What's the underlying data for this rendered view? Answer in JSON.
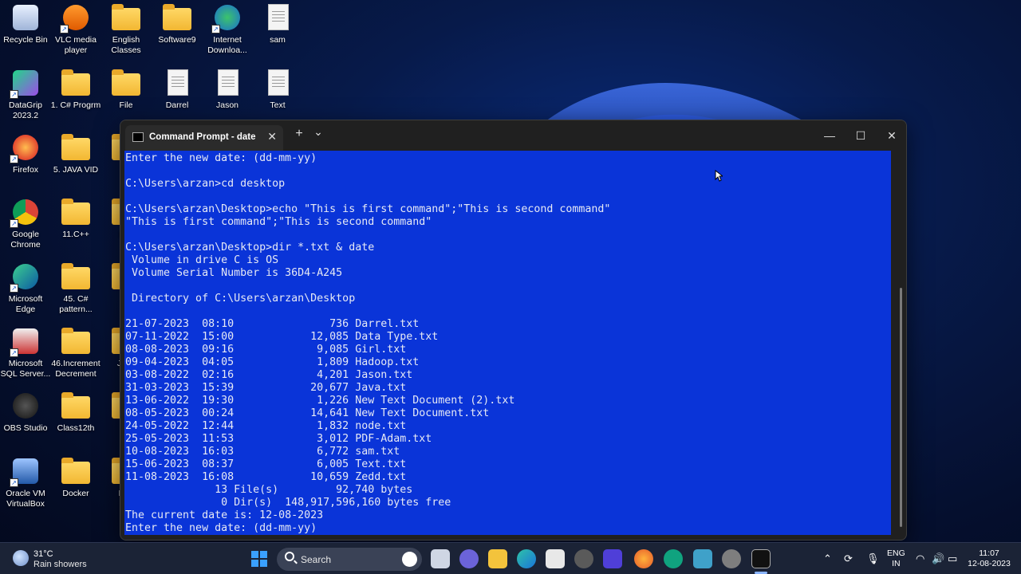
{
  "desktop": {
    "icons": [
      {
        "label": "Recycle Bin",
        "icon": "recycle-bin-icon"
      },
      {
        "label": "VLC media player",
        "icon": "vlc-icon"
      },
      {
        "label": "English Classes",
        "icon": "folder-icon"
      },
      {
        "label": "Software9",
        "icon": "folder-icon"
      },
      {
        "label": "Internet Downloa...",
        "icon": "idm-icon"
      },
      {
        "label": "sam",
        "icon": "text-file-icon"
      },
      {
        "label": "DataGrip 2023.2",
        "icon": "datagrip-icon"
      },
      {
        "label": "1. C# Progrm",
        "icon": "folder-icon"
      },
      {
        "label": "File",
        "icon": "folder-icon"
      },
      {
        "label": "Darrel",
        "icon": "text-file-icon"
      },
      {
        "label": "Jason",
        "icon": "text-file-icon"
      },
      {
        "label": "Text",
        "icon": "text-file-icon"
      },
      {
        "label": "Firefox",
        "icon": "firefox-icon"
      },
      {
        "label": "5. JAVA VID",
        "icon": "folder-icon"
      },
      {
        "label": "IN",
        "icon": "folder-icon"
      },
      {
        "label": "Google Chrome",
        "icon": "chrome-icon"
      },
      {
        "label": "11.C++",
        "icon": "folder-icon"
      },
      {
        "label": "Info",
        "icon": "folder-icon"
      },
      {
        "label": "Microsoft Edge",
        "icon": "edge-icon"
      },
      {
        "label": "45. C# pattern...",
        "icon": "folder-icon"
      },
      {
        "label": "J",
        "icon": "folder-icon"
      },
      {
        "label": "Microsoft SQL Server...",
        "icon": "sql-server-icon"
      },
      {
        "label": "46.Increment Decrement",
        "icon": "folder-icon"
      },
      {
        "label": "Java",
        "icon": "folder-icon"
      },
      {
        "label": "OBS Studio",
        "icon": "obs-icon"
      },
      {
        "label": "Class12th",
        "icon": "folder-icon"
      },
      {
        "label": "n",
        "icon": "folder-icon"
      },
      {
        "label": "Oracle VM VirtualBox",
        "icon": "virtualbox-icon"
      },
      {
        "label": "Docker",
        "icon": "folder-icon"
      },
      {
        "label": "Nati",
        "icon": "folder-icon"
      }
    ]
  },
  "window": {
    "tab_title": "Command Prompt - date",
    "tab_close": "✕",
    "new_tab": "+",
    "dropdown": "⌄",
    "minimize": "—",
    "maximize": "☐",
    "close": "✕",
    "colors": {
      "console_bg": "#0a34d8",
      "console_fg": "#e6e9f5"
    },
    "lines": [
      "Enter the new date: (dd-mm-yy)",
      "",
      "C:\\Users\\arzan>cd desktop",
      "",
      "C:\\Users\\arzan\\Desktop>echo \"This is first command\";\"This is second command\"",
      "\"This is first command\";\"This is second command\"",
      "",
      "C:\\Users\\arzan\\Desktop>dir *.txt & date",
      " Volume in drive C is OS",
      " Volume Serial Number is 36D4-A245",
      "",
      " Directory of C:\\Users\\arzan\\Desktop",
      "",
      "21-07-2023  08:10               736 Darrel.txt",
      "07-11-2022  15:00            12,085 Data Type.txt",
      "08-08-2023  09:16             9,085 Girl.txt",
      "09-04-2023  04:05             1,809 Hadoop.txt",
      "03-08-2022  02:16             4,201 Jason.txt",
      "31-03-2023  15:39            20,677 Java.txt",
      "13-06-2022  19:30             1,226 New Text Document (2).txt",
      "08-05-2023  00:24            14,641 New Text Document.txt",
      "24-05-2022  12:44             1,832 node.txt",
      "25-05-2023  11:53             3,012 PDF-Adam.txt",
      "10-08-2023  16:03             6,772 sam.txt",
      "15-06-2023  08:37             6,005 Text.txt",
      "11-08-2023  16:08            10,659 Zedd.txt",
      "              13 File(s)         92,740 bytes",
      "               0 Dir(s)  148,917,596,160 bytes free",
      "The current date is: 12-08-2023",
      "Enter the new date: (dd-mm-yy)"
    ]
  },
  "taskbar": {
    "weather_temp": "31°C",
    "weather_desc": "Rain showers",
    "search_placeholder": "Search",
    "lang_top": "ENG",
    "lang_bottom": "IN",
    "time": "11:07",
    "date": "12-08-2023"
  }
}
